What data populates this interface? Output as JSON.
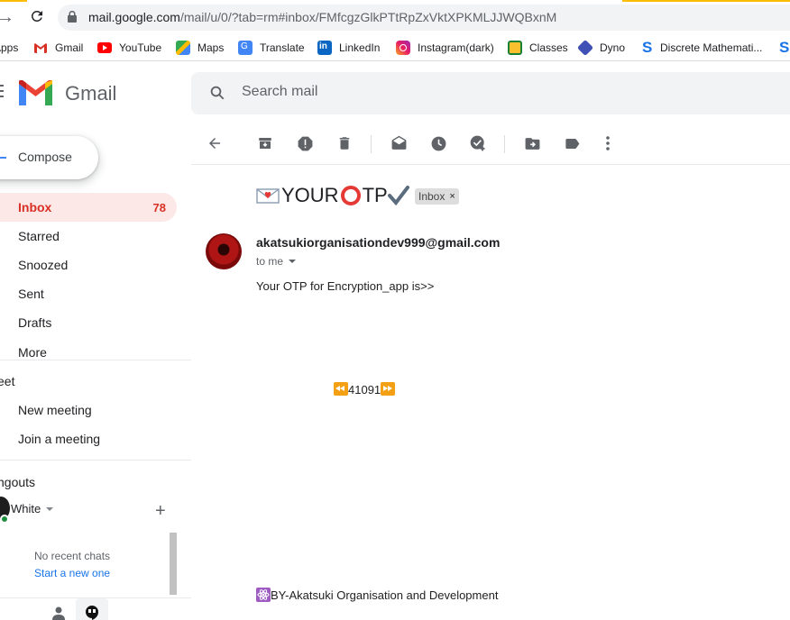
{
  "browser": {
    "url_host": "mail.google.com",
    "url_path": "/mail/u/0/?tab=rm#inbox/FMfcgzGlkPTtRpZxVktXPKMLJJWQBxnM",
    "bookmarks": [
      {
        "label": "Apps",
        "icon": "apps-grid-icon"
      },
      {
        "label": "Gmail",
        "icon": "gmail-icon"
      },
      {
        "label": "YouTube",
        "icon": "youtube-icon"
      },
      {
        "label": "Maps",
        "icon": "maps-icon"
      },
      {
        "label": "Translate",
        "icon": "translate-icon"
      },
      {
        "label": "LinkedIn",
        "icon": "linkedin-icon"
      },
      {
        "label": "Instagram(dark)",
        "icon": "instagram-icon"
      },
      {
        "label": "Classes",
        "icon": "classes-icon"
      },
      {
        "label": "Dyno",
        "icon": "dyno-icon"
      },
      {
        "label": "Discrete Mathemati...",
        "icon": "s-icon"
      }
    ]
  },
  "gmail": {
    "brand": "Gmail",
    "search_placeholder": "Search mail",
    "compose": "Compose",
    "nav": [
      {
        "label": "Inbox",
        "count": "78",
        "active": true
      },
      {
        "label": "Starred",
        "count": ""
      },
      {
        "label": "Snoozed",
        "count": ""
      },
      {
        "label": "Sent",
        "count": ""
      },
      {
        "label": "Drafts",
        "count": ""
      },
      {
        "label": "More",
        "count": ""
      }
    ],
    "meet": {
      "title": "eet",
      "items": [
        "New meeting",
        "Join a meeting"
      ]
    },
    "hangouts": {
      "title": "ngouts",
      "user": "White",
      "no_chats": "No recent chats",
      "start_new": "Start a new one"
    }
  },
  "message": {
    "subject_text_a": "YOUR ",
    "subject_text_b": "TP",
    "label_chip": "Inbox",
    "label_chip_close": "×",
    "sender": "akatsukiorganisationdev999@gmail.com",
    "to": "to me",
    "body_line": "Your OTP for Encryption_app is>>",
    "otp": "41091",
    "signature": "BY-Akatsuki Organisation and Development"
  },
  "colors": {
    "accent_red": "#d93025",
    "inbox_bg": "#fce8e6",
    "link_blue": "#1a73e8"
  }
}
